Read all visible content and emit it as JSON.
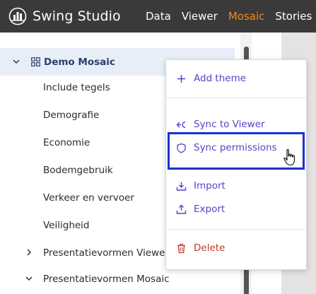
{
  "app": {
    "name": "Swing Studio",
    "logo_icon": "globe-grid-icon"
  },
  "nav": {
    "items": [
      {
        "label": "Data",
        "active": false
      },
      {
        "label": "Viewer",
        "active": false
      },
      {
        "label": "Mosaic",
        "active": true
      },
      {
        "label": "Stories",
        "active": false
      }
    ]
  },
  "tree": {
    "root": {
      "label": "Demo Mosaic",
      "expanded": true,
      "icon": "mosaic-grid-icon"
    },
    "children": [
      {
        "label": "Include tegels"
      },
      {
        "label": "Demografie"
      },
      {
        "label": "Economie"
      },
      {
        "label": "Bodemgebruik"
      },
      {
        "label": "Verkeer en vervoer"
      },
      {
        "label": "Veiligheid"
      },
      {
        "label": "Presentatievormen Viewer",
        "expanded": false
      },
      {
        "label": "Presentatievormen Mosaic",
        "expanded": true
      }
    ]
  },
  "context_menu": {
    "items": [
      {
        "label": "Add theme",
        "icon": "plus-icon"
      },
      {
        "label": "Sync to Viewer",
        "icon": "sync-arrow-icon"
      },
      {
        "label": "Sync permissions",
        "icon": "shield-icon"
      },
      {
        "label": "Import",
        "icon": "import-icon"
      },
      {
        "label": "Export",
        "icon": "export-icon"
      },
      {
        "label": "Delete",
        "icon": "trash-icon"
      }
    ]
  },
  "colors": {
    "topbar": "#3a3a3a",
    "active_nav": "#f28a1e",
    "menu_text": "#5a3fc8",
    "danger": "#c0392b",
    "highlight": "#1a2fd6",
    "selected_row": "#e8eef8"
  }
}
